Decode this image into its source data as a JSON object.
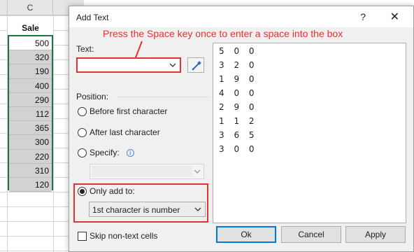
{
  "sheet": {
    "column_letter": "C",
    "header": "Sale",
    "values": [
      "500",
      "320",
      "190",
      "400",
      "290",
      "112",
      "365",
      "300",
      "220",
      "310",
      "120"
    ]
  },
  "dialog": {
    "title": "Add Text",
    "help_icon": "?",
    "close_icon": "✕",
    "annotation": "Press the Space key once to enter a space into the box",
    "text_label": "Text:",
    "text_value": "",
    "position_label": "Position:",
    "radios": {
      "before": "Before first character",
      "after": "After last character",
      "specify": "Specify:",
      "only": "Only add to:"
    },
    "only_add_to_selected": "1st character is number",
    "skip_label": "Skip non-text cells",
    "preview_lines": [
      "5 0 0",
      "3 2 0",
      "1 9 0",
      "4 0 0",
      "2 9 0",
      "1 1 2",
      "3 6 5",
      "3 0 0"
    ],
    "buttons": {
      "ok": "Ok",
      "cancel": "Cancel",
      "apply": "Apply"
    },
    "colors": {
      "highlight": "#e23333",
      "annotation": "#e63030",
      "selection": "#217346"
    }
  }
}
